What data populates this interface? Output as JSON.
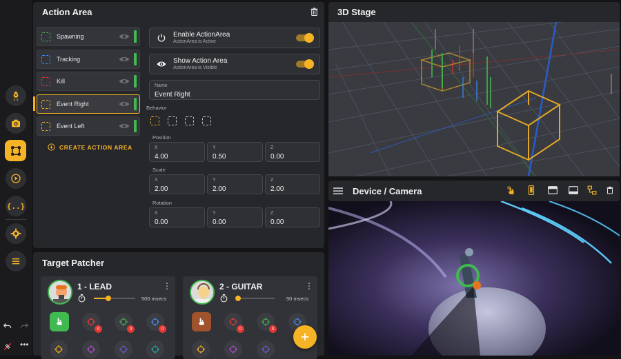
{
  "action_area": {
    "title": "Action Area",
    "items": [
      {
        "label": "Spawning",
        "color": "#3fb950"
      },
      {
        "label": "Tracking",
        "color": "#3b8ef5"
      },
      {
        "label": "Kill",
        "color": "#e53935"
      },
      {
        "label": "Event Right",
        "color": "#f5b325"
      },
      {
        "label": "Event Left",
        "color": "#f5b325"
      }
    ],
    "create_label": "CREATE ACTION AREA",
    "enable": {
      "title": "Enable ActionArea",
      "subtitle": "ActionArea is Active"
    },
    "show": {
      "title": "Show Action Area",
      "subtitle": "ActionArea is Visible"
    },
    "name_label": "Name",
    "name_value": "Event Right",
    "behavior_label": "Behavior",
    "position": {
      "label": "Position",
      "x": "4.00",
      "y": "0.50",
      "z": "0.00"
    },
    "scale": {
      "label": "Scale",
      "x": "2.00",
      "y": "2.00",
      "z": "2.00"
    },
    "rotation": {
      "label": "Rotation",
      "x": "0.00",
      "y": "0.00",
      "z": "0.00"
    },
    "axis_x": "X",
    "axis_y": "Y",
    "axis_z": "Z"
  },
  "stage": {
    "title": "3D Stage"
  },
  "camera": {
    "title": "Device / Camera"
  },
  "target_patcher": {
    "title": "Target Patcher",
    "cards": [
      {
        "name": "1 - LEAD",
        "msecs": "500 msecs",
        "slider": 0.35,
        "hand_color": "#3fb950"
      },
      {
        "name": "2 - GUITAR",
        "msecs": "50 msecs",
        "slider": 0.05,
        "hand_color": "#a0522d"
      }
    ],
    "badge": "0"
  },
  "accent": "#f5b325"
}
